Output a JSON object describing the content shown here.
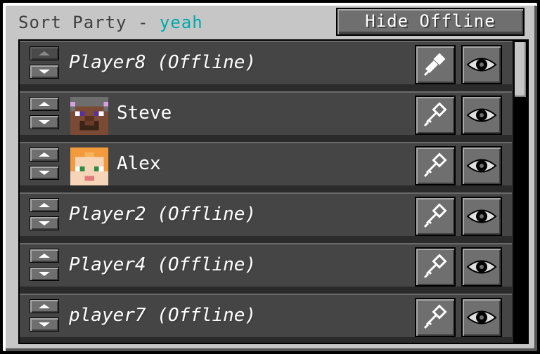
{
  "window": {
    "title_prefix": "Sort Party - ",
    "party_name": "yeah",
    "hide_offline_label": "Hide Offline"
  },
  "colors": {
    "party_name": "#00aaaa",
    "panel": "#c6c6c6",
    "row": "#454545",
    "button": "#6f6f6f"
  },
  "players": [
    {
      "name": "Player8 (Offline)",
      "online": false,
      "pin_filled": true
    },
    {
      "name": "Steve",
      "online": true,
      "avatar": "steve-face",
      "pin_filled": false
    },
    {
      "name": "Alex",
      "online": true,
      "avatar": "alex-face",
      "pin_filled": false
    },
    {
      "name": "Player2 (Offline)",
      "online": false,
      "pin_filled": false
    },
    {
      "name": "Player4 (Offline)",
      "online": false,
      "pin_filled": false
    },
    {
      "name": "player7 (Offline)",
      "online": false,
      "pin_filled": false
    }
  ],
  "icons": {
    "pin": "pin-icon",
    "eye": "eye-icon",
    "up": "arrow-up-icon",
    "down": "arrow-down-icon"
  }
}
